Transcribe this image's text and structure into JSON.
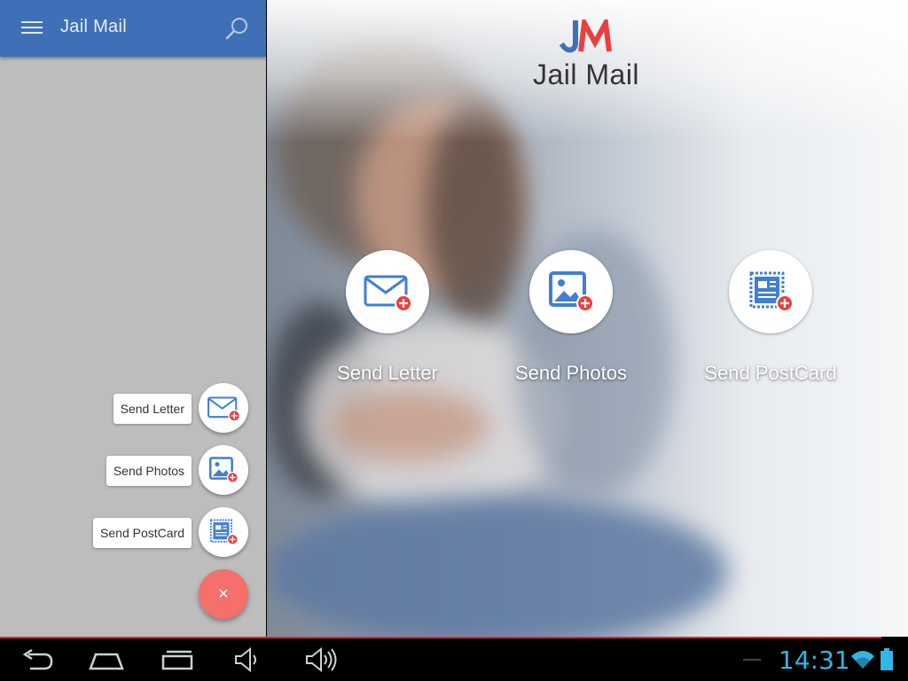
{
  "app": {
    "title": "Jail Mail",
    "brand_color": "#3f6fb6",
    "accent_red": "#e8403f",
    "fab_color": "#f5706a"
  },
  "header": {
    "menu_icon": "hamburger-menu-icon",
    "search_icon": "search-icon"
  },
  "hero": {
    "logo_mark": "JM",
    "logo_text": "Jail Mail",
    "actions": [
      {
        "label": "Send Letter",
        "icon": "envelope-plus-icon"
      },
      {
        "label": "Send Photos",
        "icon": "photo-plus-icon"
      },
      {
        "label": "Send PostCard",
        "icon": "postcard-plus-icon"
      }
    ]
  },
  "fab_menu": {
    "items": [
      {
        "label": "Send Letter",
        "icon": "envelope-plus-icon"
      },
      {
        "label": "Send Photos",
        "icon": "photo-plus-icon"
      },
      {
        "label": "Send PostCard",
        "icon": "postcard-plus-icon"
      }
    ],
    "close_label": "×",
    "close_icon": "close-icon"
  },
  "system_bar": {
    "time": "14:31",
    "time_color": "#33b5e5",
    "icons": [
      "back-icon",
      "home-icon",
      "recent-apps-icon",
      "volume-down-icon",
      "volume-up-icon",
      "wifi-icon",
      "battery-icon"
    ]
  }
}
